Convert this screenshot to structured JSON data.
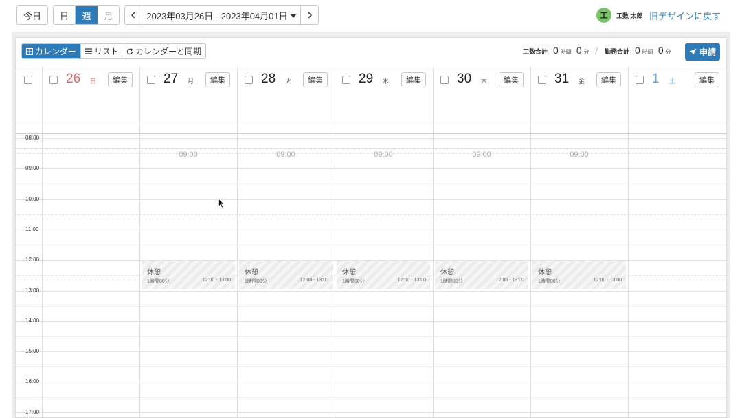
{
  "header": {
    "today_label": "今日",
    "view_day": "日",
    "view_week": "週",
    "view_month": "月",
    "prev_icon": "chevron-left-icon",
    "next_icon": "chevron-right-icon",
    "date_range": "2023年03月26日 - 2023年04月01日",
    "avatar_initial": "工",
    "user_name": "工数 太郎",
    "old_design_link": "旧デザインに戻す"
  },
  "toolbar": {
    "calendar_tab": "カレンダー",
    "list_tab": "リスト",
    "sync_button": "カレンダーと同期",
    "work_total_label": "工数合計",
    "work_total_hours": "0",
    "work_total_hours_unit": "時間",
    "work_total_minutes": "0",
    "work_total_minutes_unit": "分",
    "attendance_total_label": "勤務合計",
    "attendance_total_hours": "0",
    "attendance_total_hours_unit": "時間",
    "attendance_total_minutes": "0",
    "attendance_total_minutes_unit": "分",
    "apply_button": "申請"
  },
  "days": [
    {
      "num": "26",
      "weekday": "日",
      "edit": "編集",
      "kind": "sun"
    },
    {
      "num": "27",
      "weekday": "月",
      "edit": "編集",
      "kind": "normal"
    },
    {
      "num": "28",
      "weekday": "火",
      "edit": "編集",
      "kind": "normal"
    },
    {
      "num": "29",
      "weekday": "水",
      "edit": "編集",
      "kind": "normal"
    },
    {
      "num": "30",
      "weekday": "木",
      "edit": "編集",
      "kind": "normal"
    },
    {
      "num": "31",
      "weekday": "金",
      "edit": "編集",
      "kind": "normal"
    },
    {
      "num": "1",
      "weekday": "土",
      "edit": "編集",
      "kind": "sat"
    }
  ],
  "times": [
    "08:00",
    "09:00",
    "10:00",
    "11:00",
    "12:00",
    "13:00",
    "14:00",
    "15:00",
    "16:00",
    "17:00"
  ],
  "workday_start": "09:00",
  "break_event": {
    "title": "休憩",
    "duration": "1時間00分",
    "range": "12:00 - 13:00"
  },
  "colors": {
    "accent": "#2d7bb9",
    "sunday": "#e06666",
    "saturday": "#6fa8dc",
    "avatar": "#7ac36a"
  }
}
